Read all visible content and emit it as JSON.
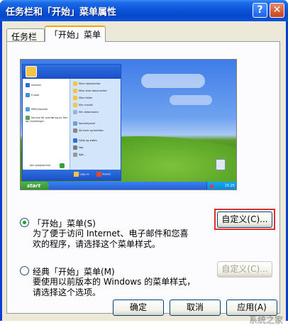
{
  "window": {
    "title": "任务栏和「开始」菜单属性",
    "help_symbol": "?",
    "close_symbol": "✕"
  },
  "tabs": [
    {
      "label": "任务栏"
    },
    {
      "label": "「开始」菜单"
    }
  ],
  "preview": {
    "startmenu_left_items": [
      "Internet",
      "E-post",
      "MSN Explorer",
      "Service for overføring av filer og innstillinger"
    ],
    "startmenu_right_items": [
      "Mine dokumenter",
      "Mine siste dokumenter",
      "Mine bilder",
      "Min musikk",
      "Min datamaskin",
      "Kontrollpanel",
      "Skrivere og telefaks",
      "Hjelp og støtte",
      "Søk",
      "Kjør..."
    ],
    "all_programs": "Alle programmer",
    "logoff": "Logg av",
    "turnoff": "Avslutt",
    "start_label": "start",
    "clock": "15:25"
  },
  "options": {
    "start_menu": {
      "label": "「开始」菜单(S)",
      "description_line1": "为了便于访问 Internet、电子邮件和您喜",
      "description_line2": "欢的程序，请选择这个菜单样式。",
      "customize_label": "自定义(C)...",
      "selected": true
    },
    "classic_menu": {
      "label": "经典「开始」菜单(M)",
      "description_line1": "要使用以前版本的 Windows 的菜单样式，",
      "description_line2": "请选择这个选项。",
      "customize_label": "自定义(C)...",
      "selected": false
    }
  },
  "buttons": {
    "ok": "确定",
    "cancel": "取消",
    "apply": "应用(A)"
  },
  "watermark": "系统之家",
  "colors": {
    "titlebar": "#0a55d8",
    "dialog_bg": "#ece9d8",
    "highlight": "#e0302a"
  }
}
